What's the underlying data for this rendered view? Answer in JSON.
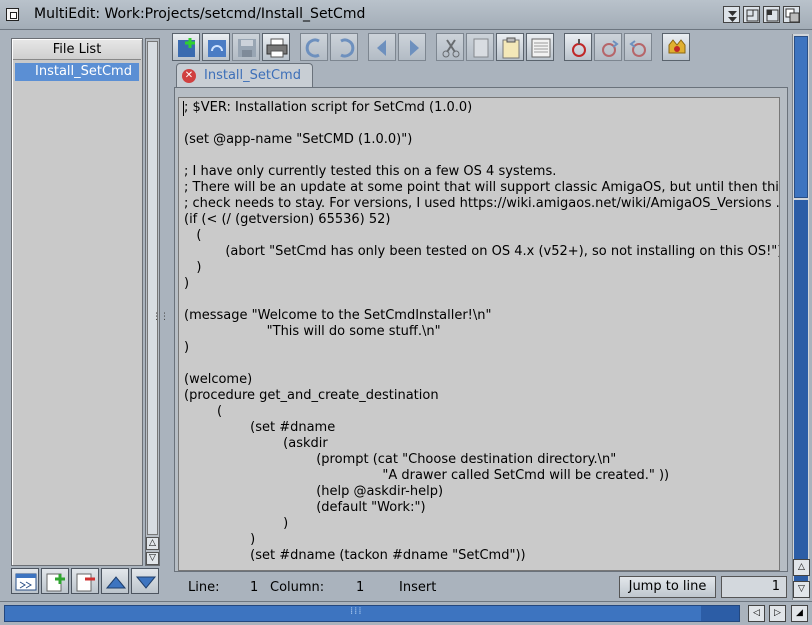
{
  "window": {
    "title": "MultiEdit: Work:Projects/setcmd/Install_SetCmd"
  },
  "file_list": {
    "header": "File List",
    "items": [
      "Install_SetCmd"
    ]
  },
  "tab": {
    "label": "Install_SetCmd"
  },
  "editor": {
    "lines": [
      "; $VER: Installation script for SetCmd (1.0.0)",
      "",
      "(set @app-name \"SetCMD (1.0.0)\")",
      "",
      "; I have only currently tested this on a few OS 4 systems.",
      "; There will be an update at some point that will support classic AmigaOS, but until then this",
      "; check needs to stay. For versions, I used https://wiki.amigaos.net/wiki/AmigaOS_Versions .",
      "(if (< (/ (getversion) 65536) 52)",
      "   (",
      "          (abort \"SetCmd has only been tested on OS 4.x (v52+), so not installing on this OS!\")",
      "   )",
      ")",
      "",
      "(message \"Welcome to the SetCmdInstaller!\\n\"",
      "                    \"This will do some stuff.\\n\"",
      ")",
      "",
      "(welcome)",
      "(procedure get_and_create_destination",
      "        (",
      "                (set #dname",
      "                        (askdir",
      "                                (prompt (cat \"Choose destination directory.\\n\"",
      "                                                \"A drawer called SetCmd will be created.\" ))",
      "                                (help @askdir-help)",
      "                                (default \"Work:\")",
      "                        )",
      "                )",
      "                (set #dname (tackon #dname \"SetCmd\"))"
    ]
  },
  "status": {
    "line_label": "Line:",
    "line_value": "1",
    "column_label": "Column:",
    "column_value": "1",
    "mode": "Insert",
    "jump_button": "Jump to line",
    "jump_field_value": "1"
  },
  "colors": {
    "accent": "#3d74c0",
    "selection": "#5b8fd4",
    "tab_text": "#3d6fb8"
  }
}
